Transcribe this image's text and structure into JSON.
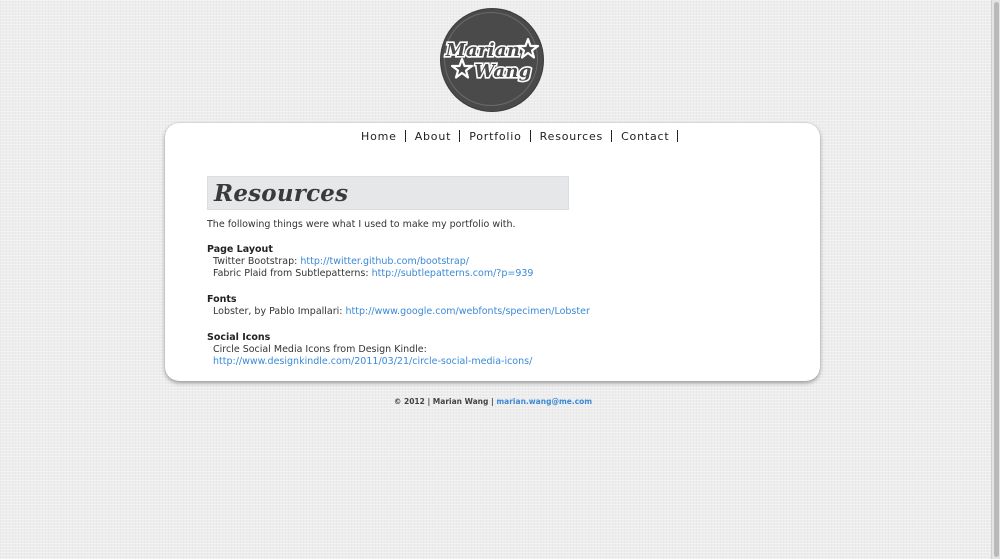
{
  "logo": {
    "line1": "Marian",
    "line2": "Wang"
  },
  "nav": {
    "items": [
      {
        "label": "Home"
      },
      {
        "label": "About"
      },
      {
        "label": "Portfolio"
      },
      {
        "label": "Resources"
      },
      {
        "label": "Contact"
      }
    ]
  },
  "page": {
    "title": "Resources",
    "intro": "The following things were what I used to make my portfolio with."
  },
  "sections": {
    "page_layout": {
      "heading": "Page Layout",
      "item1_prefix": "Twitter Bootstrap: ",
      "item1_link": "http://twitter.github.com/bootstrap/",
      "item2_prefix": "Fabric Plaid from Subtlepatterns: ",
      "item2_link": "http://subtlepatterns.com/?p=939"
    },
    "fonts": {
      "heading": "Fonts",
      "item1_prefix": "Lobster, by Pablo Impallari: ",
      "item1_link": "http://www.google.com/webfonts/specimen/Lobster"
    },
    "social_icons": {
      "heading": "Social Icons",
      "item1_text": "Circle Social Media Icons from Design Kindle:",
      "item1_link": "http://www.designkindle.com/2011/03/21/circle-social-media-icons/"
    }
  },
  "footer": {
    "text": "© 2012 | Marian Wang | ",
    "email": "marian.wang@me.com"
  },
  "colors": {
    "link": "#3a89d6",
    "title_box": "#e6e7e9",
    "logo_bg": "#4a4a4a"
  }
}
